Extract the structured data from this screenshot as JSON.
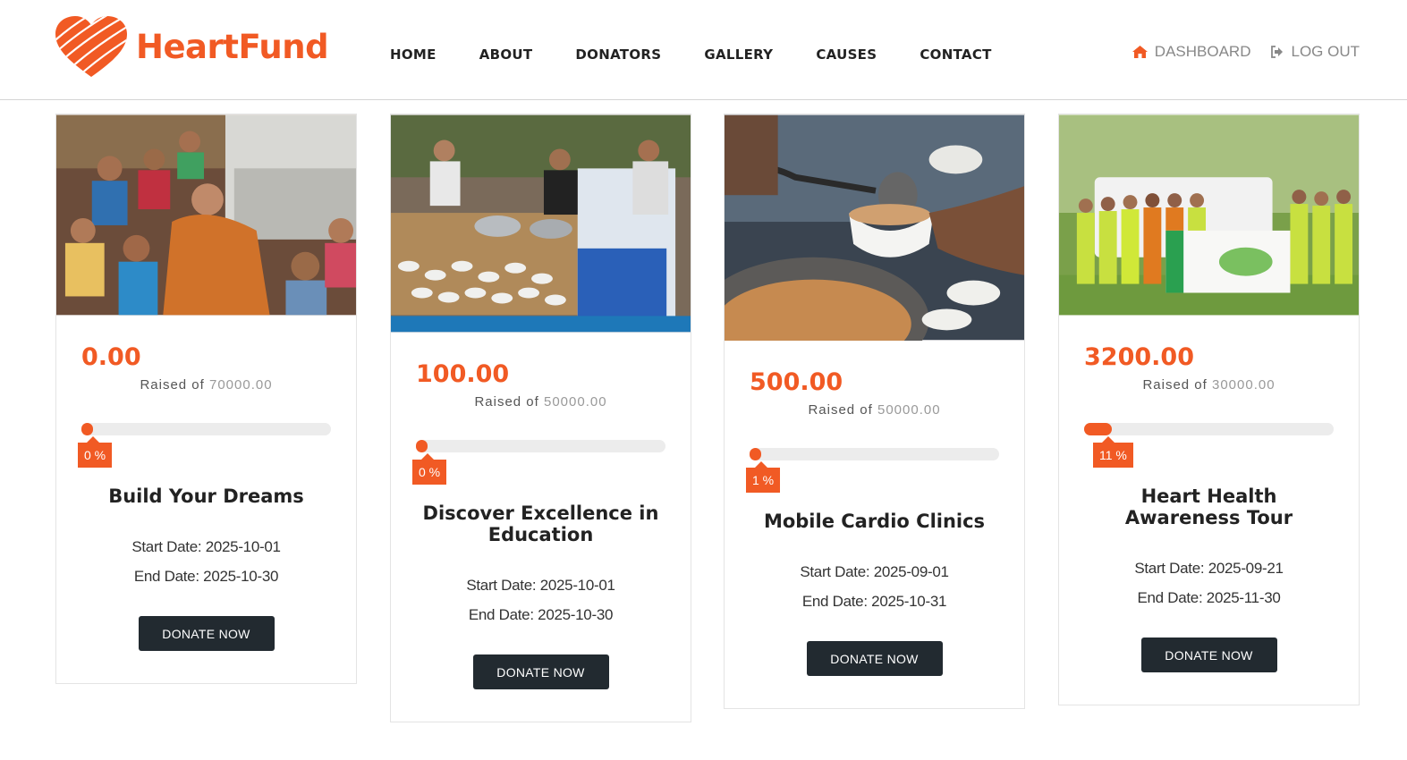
{
  "brand": {
    "name": "HeartFund",
    "color": "#f15a24",
    "icon": "heart-logo-icon"
  },
  "nav": {
    "items": [
      "HOME",
      "ABOUT",
      "DONATORS",
      "GALLERY",
      "CAUSES",
      "CONTACT"
    ]
  },
  "user": {
    "dashboard_label": "DASHBOARD",
    "dashboard_icon": "home-icon",
    "logout_label": "LOG OUT",
    "logout_icon": "sign-out-icon"
  },
  "causes": [
    {
      "amount": "0.00",
      "raised_prefix": "Raised of",
      "goal": "70000.00",
      "progress_percent": 0,
      "percent_label": "0 %",
      "title": "Build Your Dreams",
      "start_date": "Start Date: 2025-10-01",
      "end_date": "End Date: 2025-10-30",
      "button_label": "DONATE NOW"
    },
    {
      "amount": "100.00",
      "raised_prefix": "Raised of",
      "goal": "50000.00",
      "progress_percent": 0,
      "percent_label": "0 %",
      "title": "Discover Excellence in Education",
      "start_date": "Start Date: 2025-10-01",
      "end_date": "End Date: 2025-10-30",
      "button_label": "DONATE NOW"
    },
    {
      "amount": "500.00",
      "raised_prefix": "Raised of",
      "goal": "50000.00",
      "progress_percent": 1,
      "percent_label": "1 %",
      "title": "Mobile Cardio Clinics",
      "start_date": "Start Date: 2025-09-01",
      "end_date": "End Date: 2025-10-31",
      "button_label": "DONATE NOW"
    },
    {
      "amount": "3200.00",
      "raised_prefix": "Raised of",
      "goal": "30000.00",
      "progress_percent": 11,
      "percent_label": "11 %",
      "title": "Heart Health Awareness Tour",
      "start_date": "Start Date: 2025-09-21",
      "end_date": "End Date: 2025-11-30",
      "button_label": "DONATE NOW"
    }
  ]
}
